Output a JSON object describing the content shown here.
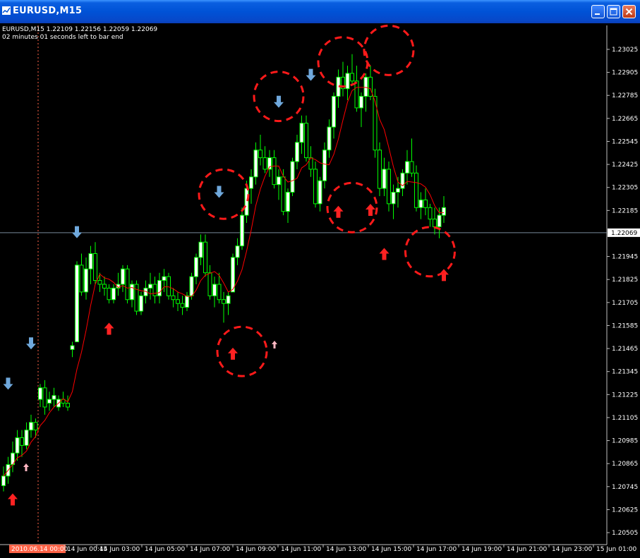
{
  "window": {
    "title": "EURUSD,M15",
    "buttons": {
      "minimize": "minimize",
      "maximize": "maximize",
      "close": "close"
    }
  },
  "chart_header": {
    "line1": "EURUSD,M15  1.22109 1.22156 1.22059 1.22069",
    "line2": "02 minutes 01 seconds left to bar end"
  },
  "colors": {
    "background": "#000000",
    "bull_candle": "#ffffff",
    "bear_candle": "#000000",
    "wick": "#00ff00",
    "moving_average": "#ff0000",
    "current_price_line": "#778899",
    "down_arrow": "#6fa8dc",
    "up_arrow": "#ff2222",
    "pale_up_arrow": "#ffb6c1",
    "highlight_circle": "#ff1a1a",
    "axis_text": "#ffffff",
    "date_marker": "#ff6347"
  },
  "price_axis": {
    "ticks": [
      "1.23025",
      "1.22905",
      "1.22785",
      "1.22665",
      "1.22545",
      "1.22425",
      "1.22305",
      "1.22185",
      "1.21945",
      "1.21825",
      "1.21705",
      "1.21585",
      "1.21465",
      "1.21345",
      "1.21225",
      "1.21105",
      "1.20985",
      "1.20865",
      "1.20745",
      "1.20625",
      "1.20505"
    ],
    "current_price": "1.22069",
    "range": [
      1.2045,
      1.2315
    ]
  },
  "time_axis": {
    "start_marker": "2010.06.14 00:00",
    "labels": [
      "14 Jun 00:45",
      "14 Jun 03:00",
      "14 Jun 05:00",
      "14 Jun 07:00",
      "14 Jun 09:00",
      "14 Jun 11:00",
      "14 Jun 13:00",
      "14 Jun 15:00",
      "14 Jun 17:00",
      "14 Jun 19:00",
      "14 Jun 21:00",
      "14 Jun 23:00",
      "15 Jun 01:00"
    ]
  },
  "chart_data": {
    "type": "candlestick",
    "symbol": "EURUSD",
    "timeframe": "M15",
    "ohlc": [
      [
        1.2075,
        1.2085,
        1.2072,
        1.208
      ],
      [
        1.208,
        1.209,
        1.2076,
        1.2086
      ],
      [
        1.2086,
        1.2098,
        1.2082,
        1.2092
      ],
      [
        1.2092,
        1.2104,
        1.2088,
        1.21
      ],
      [
        1.21,
        1.2104,
        1.209,
        1.2096
      ],
      [
        1.2096,
        1.2108,
        1.2094,
        1.2104
      ],
      [
        1.2104,
        1.2112,
        1.21,
        1.2108
      ],
      [
        1.2108,
        1.211,
        1.21,
        1.2104
      ],
      [
        1.212,
        1.2128,
        1.2116,
        1.2126
      ],
      [
        1.2126,
        1.213,
        1.2112,
        1.2116
      ],
      [
        1.2118,
        1.2124,
        1.2114,
        1.212
      ],
      [
        1.212,
        1.2126,
        1.2116,
        1.2122
      ],
      [
        1.2116,
        1.2122,
        1.2114,
        1.212
      ],
      [
        1.212,
        1.2124,
        1.2116,
        1.2118
      ],
      [
        1.2118,
        1.2122,
        1.2114,
        1.2116
      ],
      [
        1.2146,
        1.215,
        1.2142,
        1.2148
      ],
      [
        1.215,
        1.2192,
        1.215,
        1.219
      ],
      [
        1.219,
        1.2196,
        1.2174,
        1.2176
      ],
      [
        1.2176,
        1.2194,
        1.2172,
        1.2188
      ],
      [
        1.2188,
        1.22,
        1.218,
        1.2196
      ],
      [
        1.2196,
        1.2202,
        1.218,
        1.2182
      ],
      [
        1.2182,
        1.2186,
        1.2176,
        1.218
      ],
      [
        1.218,
        1.2184,
        1.2174,
        1.2178
      ],
      [
        1.2178,
        1.218,
        1.217,
        1.2172
      ],
      [
        1.2172,
        1.218,
        1.217,
        1.2178
      ],
      [
        1.2178,
        1.2186,
        1.2174,
        1.218
      ],
      [
        1.218,
        1.219,
        1.2176,
        1.2188
      ],
      [
        1.2188,
        1.219,
        1.217,
        1.2172
      ],
      [
        1.2172,
        1.2182,
        1.2168,
        1.218
      ],
      [
        1.218,
        1.2182,
        1.2164,
        1.2166
      ],
      [
        1.2166,
        1.2176,
        1.2164,
        1.2174
      ],
      [
        1.2174,
        1.2182,
        1.217,
        1.2178
      ],
      [
        1.2178,
        1.2186,
        1.2172,
        1.218
      ],
      [
        1.218,
        1.2184,
        1.217,
        1.2174
      ],
      [
        1.2174,
        1.2186,
        1.217,
        1.2182
      ],
      [
        1.2182,
        1.2188,
        1.2176,
        1.2184
      ],
      [
        1.2184,
        1.2186,
        1.2172,
        1.2174
      ],
      [
        1.2174,
        1.2178,
        1.2168,
        1.2172
      ],
      [
        1.2172,
        1.2176,
        1.2166,
        1.217
      ],
      [
        1.217,
        1.2174,
        1.2164,
        1.2168
      ],
      [
        1.2168,
        1.2176,
        1.2166,
        1.2174
      ],
      [
        1.2174,
        1.2186,
        1.2172,
        1.2184
      ],
      [
        1.2184,
        1.2196,
        1.218,
        1.2194
      ],
      [
        1.2194,
        1.2206,
        1.219,
        1.2202
      ],
      [
        1.2202,
        1.2206,
        1.2184,
        1.2186
      ],
      [
        1.2186,
        1.219,
        1.2172,
        1.2174
      ],
      [
        1.2174,
        1.2184,
        1.2168,
        1.218
      ],
      [
        1.218,
        1.2186,
        1.217,
        1.2172
      ],
      [
        1.2172,
        1.2176,
        1.216,
        1.217
      ],
      [
        1.217,
        1.2176,
        1.2164,
        1.2174
      ],
      [
        1.2176,
        1.2196,
        1.2176,
        1.2194
      ],
      [
        1.2194,
        1.2204,
        1.219,
        1.22
      ],
      [
        1.22,
        1.222,
        1.2198,
        1.2216
      ],
      [
        1.2216,
        1.2234,
        1.2212,
        1.223
      ],
      [
        1.223,
        1.224,
        1.2222,
        1.2236
      ],
      [
        1.2236,
        1.2254,
        1.2232,
        1.225
      ],
      [
        1.225,
        1.2258,
        1.2242,
        1.2246
      ],
      [
        1.2246,
        1.2252,
        1.2238,
        1.224
      ],
      [
        1.224,
        1.225,
        1.2236,
        1.2246
      ],
      [
        1.2246,
        1.225,
        1.223,
        1.2232
      ],
      [
        1.2232,
        1.224,
        1.2224,
        1.2236
      ],
      [
        1.2236,
        1.224,
        1.2216,
        1.2218
      ],
      [
        1.2218,
        1.223,
        1.2212,
        1.2228
      ],
      [
        1.2228,
        1.2246,
        1.2226,
        1.2244
      ],
      [
        1.2244,
        1.2258,
        1.224,
        1.2254
      ],
      [
        1.2254,
        1.2268,
        1.2248,
        1.2264
      ],
      [
        1.2264,
        1.2268,
        1.2244,
        1.2246
      ],
      [
        1.2246,
        1.2252,
        1.2236,
        1.224
      ],
      [
        1.224,
        1.2244,
        1.222,
        1.2222
      ],
      [
        1.2222,
        1.2236,
        1.2218,
        1.2234
      ],
      [
        1.2234,
        1.2254,
        1.223,
        1.225
      ],
      [
        1.225,
        1.2266,
        1.2246,
        1.2262
      ],
      [
        1.2262,
        1.228,
        1.2256,
        1.2278
      ],
      [
        1.2278,
        1.2292,
        1.2272,
        1.2288
      ],
      [
        1.2288,
        1.2296,
        1.2278,
        1.2282
      ],
      [
        1.2282,
        1.2294,
        1.2276,
        1.229
      ],
      [
        1.229,
        1.23,
        1.2284,
        1.2286
      ],
      [
        1.2286,
        1.2294,
        1.227,
        1.2272
      ],
      [
        1.2272,
        1.228,
        1.2262,
        1.2278
      ],
      [
        1.2278,
        1.229,
        1.227,
        1.2288
      ],
      [
        1.2288,
        1.2294,
        1.2276,
        1.2278
      ],
      [
        1.2278,
        1.2282,
        1.2246,
        1.225
      ],
      [
        1.225,
        1.2254,
        1.2226,
        1.223
      ],
      [
        1.223,
        1.2246,
        1.2226,
        1.224
      ],
      [
        1.224,
        1.2244,
        1.2218,
        1.2222
      ],
      [
        1.2222,
        1.2232,
        1.2214,
        1.2228
      ],
      [
        1.2228,
        1.2236,
        1.222,
        1.223
      ],
      [
        1.223,
        1.224,
        1.2226,
        1.2238
      ],
      [
        1.2238,
        1.225,
        1.2232,
        1.2244
      ],
      [
        1.2244,
        1.2256,
        1.2236,
        1.2238
      ],
      [
        1.2238,
        1.2242,
        1.2218,
        1.222
      ],
      [
        1.222,
        1.2228,
        1.2214,
        1.2224
      ],
      [
        1.2224,
        1.223,
        1.2216,
        1.222
      ],
      [
        1.222,
        1.2222,
        1.221,
        1.2214
      ],
      [
        1.2214,
        1.222,
        1.2206,
        1.221
      ],
      [
        1.221,
        1.222,
        1.2204,
        1.2216
      ],
      [
        1.2216,
        1.2226,
        1.2212,
        1.222
      ]
    ],
    "markers": [
      {
        "type": "down",
        "bar": 1,
        "price": 1.2128
      },
      {
        "type": "down",
        "bar": 6,
        "price": 1.2149
      },
      {
        "type": "down",
        "bar": 16,
        "price": 1.2207
      },
      {
        "type": "down",
        "bar": 47,
        "price": 1.2228
      },
      {
        "type": "down",
        "bar": 60,
        "price": 1.2275
      },
      {
        "type": "down",
        "bar": 67,
        "price": 1.2289
      },
      {
        "type": "up",
        "bar": 2,
        "price": 1.2068
      },
      {
        "type": "up",
        "bar": 23,
        "price": 1.2157
      },
      {
        "type": "up",
        "bar": 50,
        "price": 1.2144
      },
      {
        "type": "up",
        "bar": 73,
        "price": 1.2218
      },
      {
        "type": "up",
        "bar": 80,
        "price": 1.2219
      },
      {
        "type": "up",
        "bar": 83,
        "price": 1.2196
      },
      {
        "type": "up",
        "bar": 96,
        "price": 1.2185
      }
    ],
    "highlight_circles": [
      {
        "bar": 48,
        "price": 1.2227
      },
      {
        "bar": 60,
        "price": 1.2278
      },
      {
        "bar": 74,
        "price": 1.2296
      },
      {
        "bar": 84,
        "price": 1.2302
      },
      {
        "bar": 52,
        "price": 1.2145
      },
      {
        "bar": 76,
        "price": 1.222
      },
      {
        "bar": 93,
        "price": 1.2197
      }
    ]
  }
}
